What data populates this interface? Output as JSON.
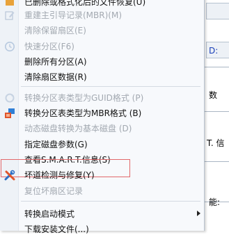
{
  "menu": {
    "items": [
      {
        "label": "已删除或格式化后的文件恢复(U)"
      },
      {
        "label": "重建主引导记录(MBR)(M)",
        "disabled": true,
        "icon": "edit-doc-icon"
      },
      {
        "label": "清除保留扇区(E)",
        "disabled": true
      },
      {
        "label": "快速分区(F6)",
        "disabled": true,
        "icon": "clock-icon"
      },
      {
        "label": "删除所有分区(A)"
      },
      {
        "label": "清除扇区数据(R)"
      },
      {
        "label": "转换分区表类型为GUID格式 (P)",
        "disabled": true,
        "icon": "convert-icon"
      },
      {
        "label": "转换分区表类型为MBR格式 (B)",
        "icon": "convert-mbr-icon"
      },
      {
        "label": "动态磁盘转换为基本磁盘 (D)",
        "disabled": true
      },
      {
        "label": "指定磁盘参数(G)"
      },
      {
        "label": "查看S.M.A.R.T.信息(S)"
      },
      {
        "label": "坏道检测与修复(Y)",
        "icon": "tools-icon",
        "highlighted": true
      },
      {
        "label": "复位坏扇区记录",
        "disabled": true
      },
      {
        "label": "转换启动模式",
        "submenu": true
      },
      {
        "label": "下载安装文件(...)"
      }
    ]
  },
  "background": {
    "fragments": [
      "D:",
      "数",
      "T. 信",
      "能:"
    ]
  },
  "colors": {
    "highlight_border": "#e2686a",
    "disabled_text": "#a3a9b1"
  }
}
